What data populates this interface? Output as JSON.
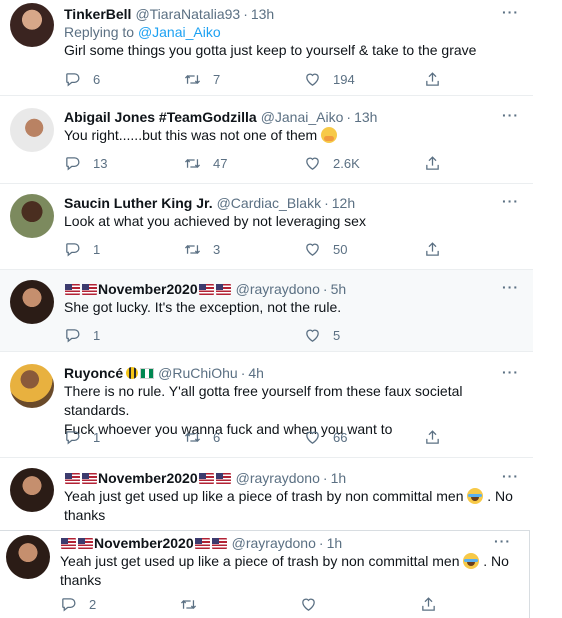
{
  "tweets": [
    {
      "name": "TinkerBell",
      "handle": "@TiaraNatalia93",
      "time": "13h",
      "more": "···",
      "replying_prefix": "Replying to",
      "replying_to": "@Janai_Aiko",
      "text": "Girl some things you gotta just keep to yourself & take to the grave",
      "replies": "6",
      "retweets": "7",
      "likes": "194"
    },
    {
      "name": "Abigail Jones #TeamGodzilla",
      "handle": "@Janai_Aiko",
      "time": "13h",
      "more": "···",
      "text": "You right......but this was not one of them",
      "emoji": "hugging-face-emoji",
      "replies": "13",
      "retweets": "47",
      "likes": "2.6K"
    },
    {
      "name": "Saucin Luther King Jr.",
      "handle": "@Cardiac_Blakk",
      "time": "12h",
      "more": "···",
      "text": "Look at what you achieved by not leveraging sex",
      "replies": "1",
      "retweets": "3",
      "likes": "50"
    },
    {
      "name": "November2020",
      "handle": "@rayraydono",
      "time": "5h",
      "more": "···",
      "text": "She got lucky. It's the exception, not the rule.",
      "replies": "1",
      "retweets": "",
      "likes": "5"
    },
    {
      "name": "Ruyoncé",
      "handle": "@RuChiOhu",
      "time": "4h",
      "more": "···",
      "text_line1": "There is no rule. Y'all gotta free yourself from these faux societal standards.",
      "text_line2": "Fuck whoever you wanna fuck and when you want to",
      "replies": "1",
      "retweets": "6",
      "likes": "66"
    },
    {
      "name": "November2020",
      "handle": "@rayraydono",
      "time": "1h",
      "more": "···",
      "text_line1": "Yeah just get used up like a piece of trash by non committal men",
      "text_suffix": ". No",
      "text_line2": "thanks",
      "emoji": "loudly-crying-face-emoji"
    },
    {
      "name": "November2020",
      "handle": "@rayraydono",
      "time": "1h",
      "more": "···",
      "text_line1": "Yeah just get used up like a piece of trash by non committal men",
      "text_suffix": ". No",
      "text_line2": "thanks",
      "emoji": "loudly-crying-face-emoji",
      "replies": "2",
      "retweets": "",
      "likes": ""
    }
  ],
  "dot": "·",
  "colors": {
    "accent": "#1da1f2",
    "secondary_text": "#5b7083",
    "primary_text": "#0f1419"
  }
}
